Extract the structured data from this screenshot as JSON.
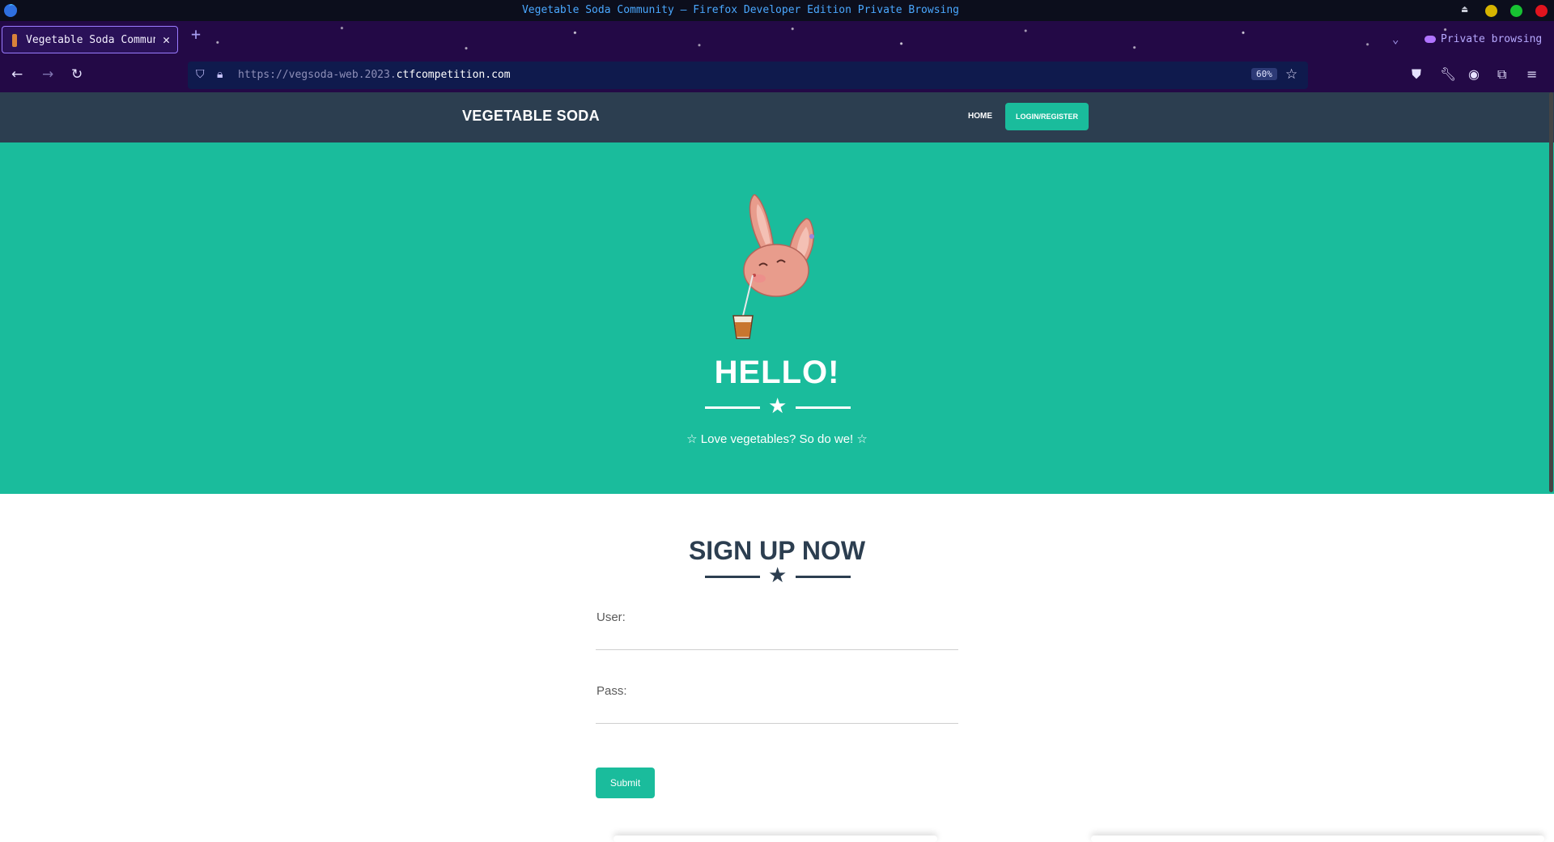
{
  "window": {
    "title": "Vegetable Soda Community — Firefox Developer Edition Private Browsing"
  },
  "tabs": [
    {
      "label": "Vegetable Soda Community"
    }
  ],
  "browser": {
    "private_label": "Private browsing",
    "url_prefix": "https://vegsoda-web.2023.",
    "url_host": "ctfcompetition.com",
    "zoom": "60%"
  },
  "site": {
    "brand": "VEGETABLE SODA",
    "nav": {
      "home": "HOME",
      "login": "LOGIN/REGISTER"
    },
    "hero": {
      "title": "HELLO!",
      "subtitle": "☆ Love vegetables? So do we! ☆"
    },
    "signup": {
      "title": "SIGN UP NOW",
      "user_label": "User:",
      "pass_label": "Pass:",
      "submit_label": "Submit"
    }
  },
  "colors": {
    "accent": "#1abc9c",
    "navbar": "#2c3e50",
    "browser_chrome": "#230946"
  }
}
